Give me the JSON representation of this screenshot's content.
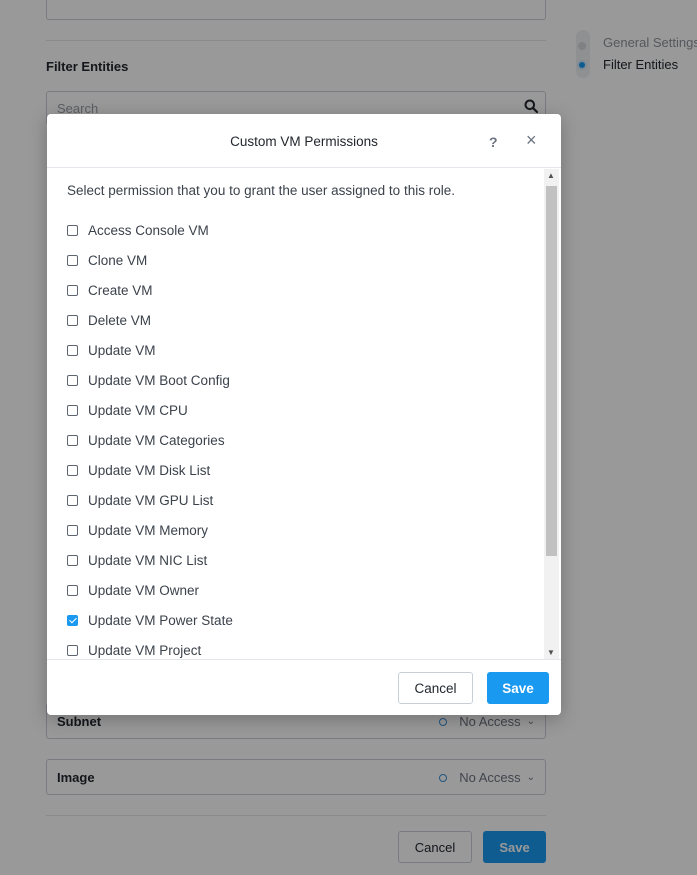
{
  "background": {
    "section_title": "Filter Entities",
    "search_placeholder": "Search",
    "entities": [
      {
        "name": "Subnet",
        "access": "No Access"
      },
      {
        "name": "Image",
        "access": "No Access"
      }
    ],
    "cancel_label": "Cancel",
    "save_label": "Save",
    "nav": [
      {
        "label": "General Settings",
        "active": false
      },
      {
        "label": "Filter Entities",
        "active": true
      }
    ]
  },
  "modal": {
    "title": "Custom VM Permissions",
    "help_icon": "?",
    "close_icon": "×",
    "instruction": "Select permission that you to grant the user assigned to this role.",
    "permissions": [
      {
        "label": "Access Console VM",
        "checked": false
      },
      {
        "label": "Clone VM",
        "checked": false
      },
      {
        "label": "Create VM",
        "checked": false
      },
      {
        "label": "Delete VM",
        "checked": false
      },
      {
        "label": "Update VM",
        "checked": false
      },
      {
        "label": "Update VM Boot Config",
        "checked": false
      },
      {
        "label": "Update VM CPU",
        "checked": false
      },
      {
        "label": "Update VM Categories",
        "checked": false
      },
      {
        "label": "Update VM Disk List",
        "checked": false
      },
      {
        "label": "Update VM GPU List",
        "checked": false
      },
      {
        "label": "Update VM Memory",
        "checked": false
      },
      {
        "label": "Update VM NIC List",
        "checked": false
      },
      {
        "label": "Update VM Owner",
        "checked": false
      },
      {
        "label": "Update VM Power State",
        "checked": true
      },
      {
        "label": "Update VM Project",
        "checked": false
      }
    ],
    "cancel_label": "Cancel",
    "save_label": "Save"
  },
  "colors": {
    "accent": "#1a99f1",
    "overlay": "rgba(0,0,0,0.40)"
  }
}
